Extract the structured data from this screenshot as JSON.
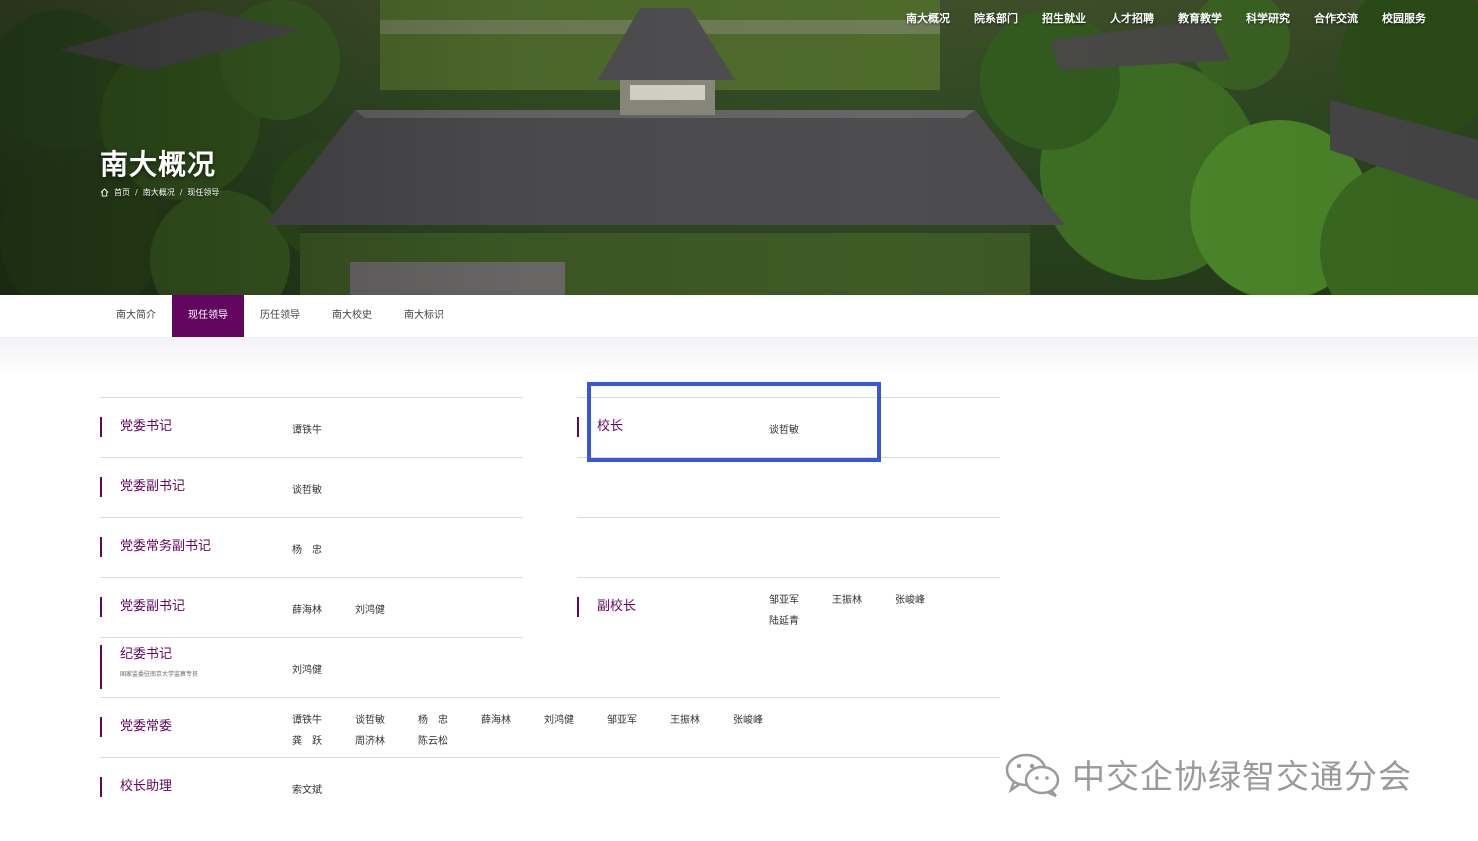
{
  "topnav": {
    "items": [
      "南大概况",
      "院系部门",
      "招生就业",
      "人才招聘",
      "教育教学",
      "科学研究",
      "合作交流",
      "校园服务"
    ]
  },
  "hero": {
    "title": "南大概况",
    "breadcrumb": [
      "首页",
      "南大概况",
      "现任领导"
    ]
  },
  "subnav": {
    "tabs": [
      "南大简介",
      "现任领导",
      "历任领导",
      "南大校史",
      "南大标识"
    ],
    "active_index": 1,
    "active_color": "#63065f"
  },
  "left_rows": [
    {
      "role": "党委书记",
      "names": [
        "谭铁牛"
      ]
    },
    {
      "role": "党委副书记",
      "names": [
        "谈哲敏"
      ]
    },
    {
      "role": "党委常务副书记",
      "names": [
        "杨　忠"
      ]
    },
    {
      "role": "党委副书记",
      "names": [
        "薛海林",
        "刘鸿健"
      ]
    },
    {
      "role": "纪委书记",
      "note": "国家监委驻南京大学监察专员",
      "names": [
        "刘鸿健"
      ]
    }
  ],
  "right_rows": [
    {
      "role": "校长",
      "names": [
        "谈哲敏"
      ]
    },
    {
      "role": "副校长",
      "names": [
        "邹亚军",
        "王振林",
        "张峻峰",
        "陆延青"
      ]
    }
  ],
  "full_rows": [
    {
      "role": "党委常委",
      "names": [
        "谭铁牛",
        "谈哲敏",
        "杨　忠",
        "薛海林",
        "刘鸿健",
        "邹亚军",
        "王振林",
        "张峻峰",
        "龚　跃",
        "周济林",
        "陈云松"
      ]
    },
    {
      "role": "校长助理",
      "names": [
        "索文斌"
      ]
    }
  ],
  "watermark": {
    "text": "中交企协绿智交通分会",
    "icon": "wechat-icon"
  },
  "colors": {
    "accent": "#63065f",
    "highlight": "#3657d6"
  }
}
